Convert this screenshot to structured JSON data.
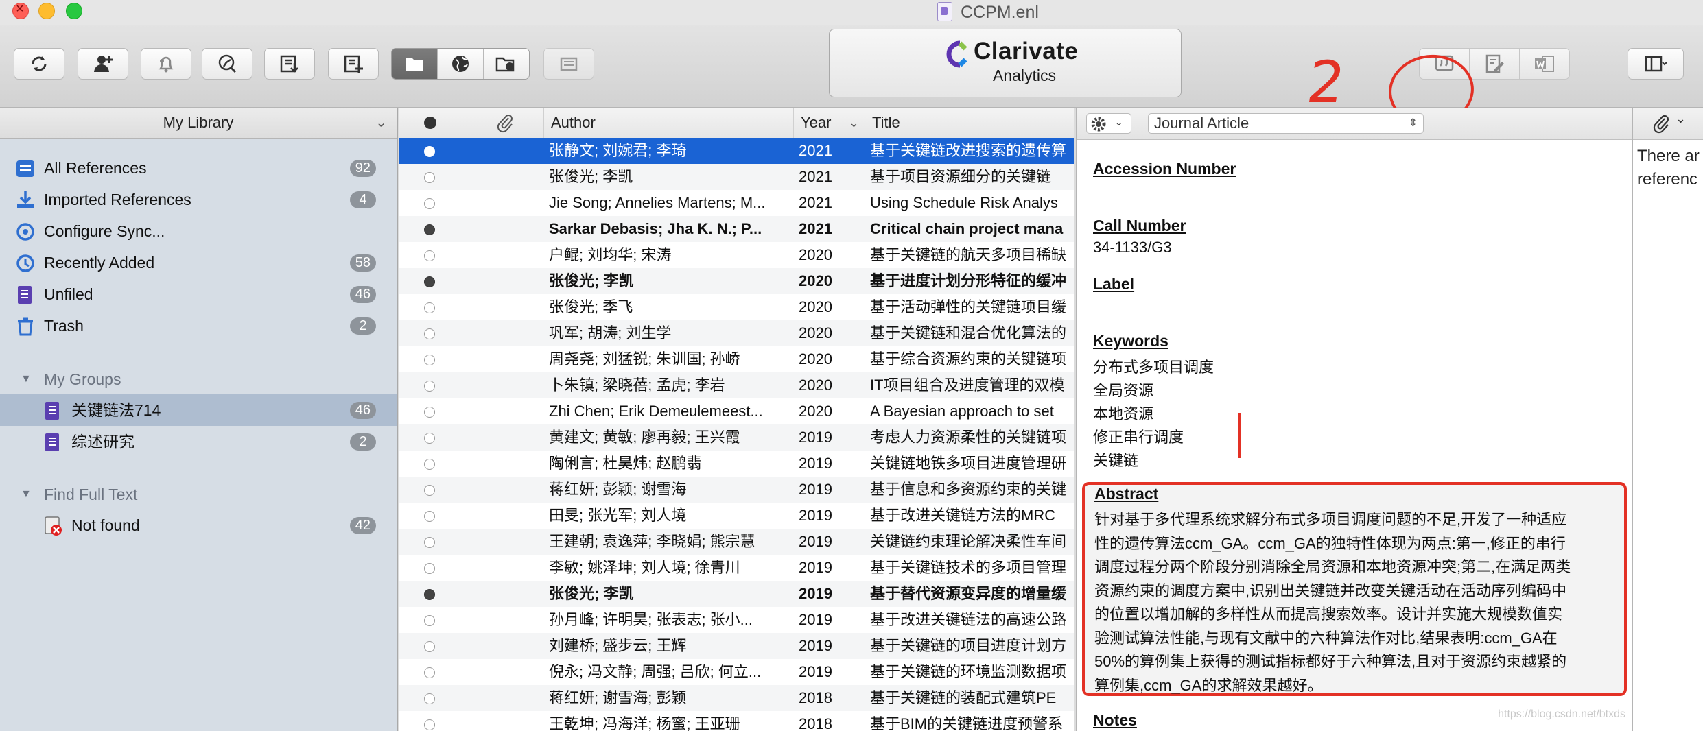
{
  "window": {
    "title": "CCPM.enl"
  },
  "toolbar": {
    "logo_main": "Clarivate",
    "logo_sub": "Analytics",
    "annotation_number": "2"
  },
  "sidebar": {
    "header": "My Library",
    "items": [
      {
        "label": "All References",
        "count": "92"
      },
      {
        "label": "Imported References",
        "count": "4"
      },
      {
        "label": "Configure Sync...",
        "count": ""
      },
      {
        "label": "Recently Added",
        "count": "58"
      },
      {
        "label": "Unfiled",
        "count": "46"
      },
      {
        "label": "Trash",
        "count": "2"
      }
    ],
    "groups_header": "My Groups",
    "groups": [
      {
        "label": "关键链法714",
        "count": "46"
      },
      {
        "label": "综述研究",
        "count": "2"
      }
    ],
    "fulltext_header": "Find Full Text",
    "fulltext": [
      {
        "label": "Not found",
        "count": "42"
      }
    ]
  },
  "list": {
    "headers": {
      "author": "Author",
      "year": "Year",
      "title": "Title"
    },
    "rows": [
      {
        "author": "张静文; 刘婉君; 李琦",
        "year": "2021",
        "title": "基于关键链改进搜索的遗传算",
        "read": false,
        "selected": true
      },
      {
        "author": "张俊光; 李凯",
        "year": "2021",
        "title": "基于项目资源细分的关键链",
        "read": true
      },
      {
        "author": "Jie Song; Annelies Martens; M...",
        "year": "2021",
        "title": "Using Schedule Risk Analys",
        "read": true
      },
      {
        "author": "Sarkar Debasis; Jha K. N.; P...",
        "year": "2021",
        "title": "Critical chain project mana",
        "read": false
      },
      {
        "author": "户鲲; 刘均华; 宋涛",
        "year": "2020",
        "title": "基于关键链的航天多项目稀缺",
        "read": true
      },
      {
        "author": "张俊光; 李凯",
        "year": "2020",
        "title": "基于进度计划分形特征的缓冲",
        "read": false
      },
      {
        "author": "张俊光; 季飞",
        "year": "2020",
        "title": "基于活动弹性的关键链项目缓",
        "read": true
      },
      {
        "author": "巩军; 胡涛; 刘生学",
        "year": "2020",
        "title": "基于关键链和混合优化算法的",
        "read": true
      },
      {
        "author": "周尧尧; 刘猛锐; 朱训国; 孙峤",
        "year": "2020",
        "title": "基于综合资源约束的关键链项",
        "read": true
      },
      {
        "author": "卜朱镇; 梁晓蓓; 孟虎; 李岩",
        "year": "2020",
        "title": "IT项目组合及进度管理的双模",
        "read": true
      },
      {
        "author": "Zhi Chen; Erik Demeulemeest...",
        "year": "2020",
        "title": "A Bayesian approach to set",
        "read": true
      },
      {
        "author": "黄建文; 黄敏; 廖再毅; 王兴霞",
        "year": "2019",
        "title": "考虑人力资源柔性的关键链项",
        "read": true
      },
      {
        "author": "陶俐言; 杜昊炜; 赵鹏翡",
        "year": "2019",
        "title": "关键链地铁多项目进度管理研",
        "read": true
      },
      {
        "author": "蒋红妍; 彭颖; 谢雪海",
        "year": "2019",
        "title": "基于信息和多资源约束的关键",
        "read": true
      },
      {
        "author": "田旻; 张光军; 刘人境",
        "year": "2019",
        "title": "基于改进关键链方法的MRC",
        "read": true
      },
      {
        "author": "王建朝; 袁逸萍; 李晓娟; 熊宗慧",
        "year": "2019",
        "title": "关键链约束理论解决柔性车间",
        "read": true
      },
      {
        "author": "李敏; 姚泽坤; 刘人境; 徐青川",
        "year": "2019",
        "title": "基于关键链技术的多项目管理",
        "read": true
      },
      {
        "author": "张俊光; 李凯",
        "year": "2019",
        "title": "基于替代资源变异度的增量缓",
        "read": false
      },
      {
        "author": "孙月峰; 许明昊; 张表志; 张小...",
        "year": "2019",
        "title": "基于改进关键链法的高速公路",
        "read": true
      },
      {
        "author": "刘建桥; 盛步云; 王辉",
        "year": "2019",
        "title": "基于关键链的项目进度计划方",
        "read": true
      },
      {
        "author": "倪永; 冯文静; 周强; 吕欣; 何立...",
        "year": "2019",
        "title": "基于关键链的环境监测数据项",
        "read": true
      },
      {
        "author": "蒋红妍; 谢雪海; 彭颖",
        "year": "2018",
        "title": "基于关键链的装配式建筑PE",
        "read": true
      },
      {
        "author": "王乾坤; 冯海洋; 杨蜜; 王亚珊",
        "year": "2018",
        "title": "基于BIM的关键链进度预警系",
        "read": true
      }
    ]
  },
  "detail": {
    "ref_type": "Journal Article",
    "accession_label": "Accession Number",
    "call_label": "Call Number",
    "call_value": "34-1133/G3",
    "label_label": "Label",
    "keywords_label": "Keywords",
    "keywords": [
      "分布式多项目调度",
      "全局资源",
      "本地资源",
      "修正串行调度",
      "关键链"
    ],
    "abstract_label": "Abstract",
    "abstract_lines": [
      "针对基于多代理系统求解分布式多项目调度问题的不足,开发了一种适应",
      "性的遗传算法ccm_GA。ccm_GA的独特性体现为两点:第一,修正的串行",
      "调度过程分两个阶段分别消除全局资源和本地资源冲突;第二,在满足两类",
      "资源约束的调度方案中,识别出关键链并改变关键活动在活动序列编码中",
      "的位置以增加解的多样性从而提高搜索效率。设计并实施大规模数值实",
      "验测试算法性能,与现有文献中的六种算法作对比,结果表明:ccm_GA在",
      "50%的算例集上获得的测试指标都好于六种算法,且对于资源约束越紧的",
      "算例集,ccm_GA的求解效果越好。"
    ],
    "notes_label": "Notes",
    "watermark": "https://blog.csdn.net/btxds"
  },
  "right_panel": {
    "line1": "There ar",
    "line2": "referenc"
  },
  "colors": {
    "annotation": "#e33125",
    "selection": "#1a63d4",
    "sidebar_bg": "#d6dde5"
  }
}
